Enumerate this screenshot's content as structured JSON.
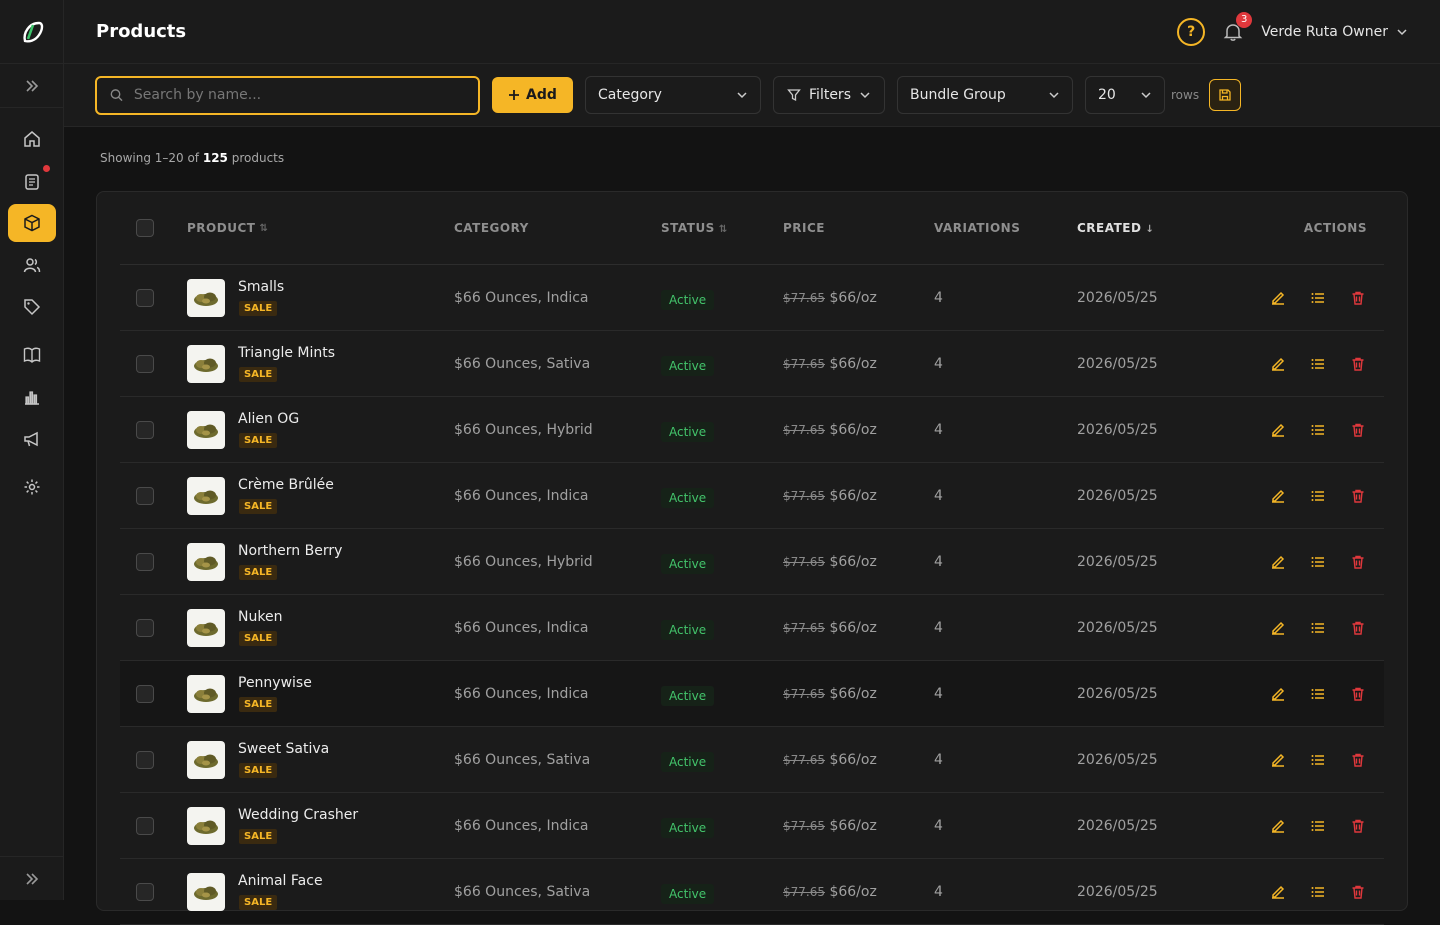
{
  "header": {
    "title": "Products",
    "notifications": "3",
    "user": "Verde Ruta Owner"
  },
  "toolbar": {
    "search_placeholder": "Search by name...",
    "add_label": "Add",
    "category_label": "Category",
    "filters_label": "Filters",
    "bundle_label": "Bundle Group",
    "rows_value": "20",
    "rows_label": "rows"
  },
  "summary": {
    "prefix": "Showing 1–20 of ",
    "total": "125",
    "suffix": " products"
  },
  "columns": {
    "product": "PRODUCT",
    "category": "CATEGORY",
    "status": "STATUS",
    "price": "PRICE",
    "variations": "VARIATIONS",
    "created": "CREATED",
    "actions": "ACTIONS"
  },
  "colors": {
    "accent": "#f5b626",
    "active_status": "#43c46b",
    "delete": "#e0383c"
  },
  "products": [
    {
      "name": "Smalls",
      "badge": "SALE",
      "category": "$66 Ounces, Indica",
      "status": "Active",
      "old_price": "$77.65",
      "price": "$66/oz",
      "variations": "4",
      "created": "2026/05/25"
    },
    {
      "name": "Triangle Mints",
      "badge": "SALE",
      "category": "$66 Ounces, Sativa",
      "status": "Active",
      "old_price": "$77.65",
      "price": "$66/oz",
      "variations": "4",
      "created": "2026/05/25"
    },
    {
      "name": "Alien OG",
      "badge": "SALE",
      "category": "$66 Ounces, Hybrid",
      "status": "Active",
      "old_price": "$77.65",
      "price": "$66/oz",
      "variations": "4",
      "created": "2026/05/25"
    },
    {
      "name": "Crème Brûlée",
      "badge": "SALE",
      "category": "$66 Ounces, Indica",
      "status": "Active",
      "old_price": "$77.65",
      "price": "$66/oz",
      "variations": "4",
      "created": "2026/05/25"
    },
    {
      "name": "Northern Berry",
      "badge": "SALE",
      "category": "$66 Ounces, Hybrid",
      "status": "Active",
      "old_price": "$77.65",
      "price": "$66/oz",
      "variations": "4",
      "created": "2026/05/25"
    },
    {
      "name": "Nuken",
      "badge": "SALE",
      "category": "$66 Ounces, Indica",
      "status": "Active",
      "old_price": "$77.65",
      "price": "$66/oz",
      "variations": "4",
      "created": "2026/05/25"
    },
    {
      "name": "Pennywise",
      "badge": "SALE",
      "category": "$66 Ounces, Indica",
      "status": "Active",
      "old_price": "$77.65",
      "price": "$66/oz",
      "variations": "4",
      "created": "2026/05/25"
    },
    {
      "name": "Sweet Sativa",
      "badge": "SALE",
      "category": "$66 Ounces, Sativa",
      "status": "Active",
      "old_price": "$77.65",
      "price": "$66/oz",
      "variations": "4",
      "created": "2026/05/25"
    },
    {
      "name": "Wedding Crasher",
      "badge": "SALE",
      "category": "$66 Ounces, Indica",
      "status": "Active",
      "old_price": "$77.65",
      "price": "$66/oz",
      "variations": "4",
      "created": "2026/05/25"
    },
    {
      "name": "Animal Face",
      "badge": "SALE",
      "category": "$66 Ounces, Sativa",
      "status": "Active",
      "old_price": "$77.65",
      "price": "$66/oz",
      "variations": "4",
      "created": "2026/05/25"
    }
  ]
}
